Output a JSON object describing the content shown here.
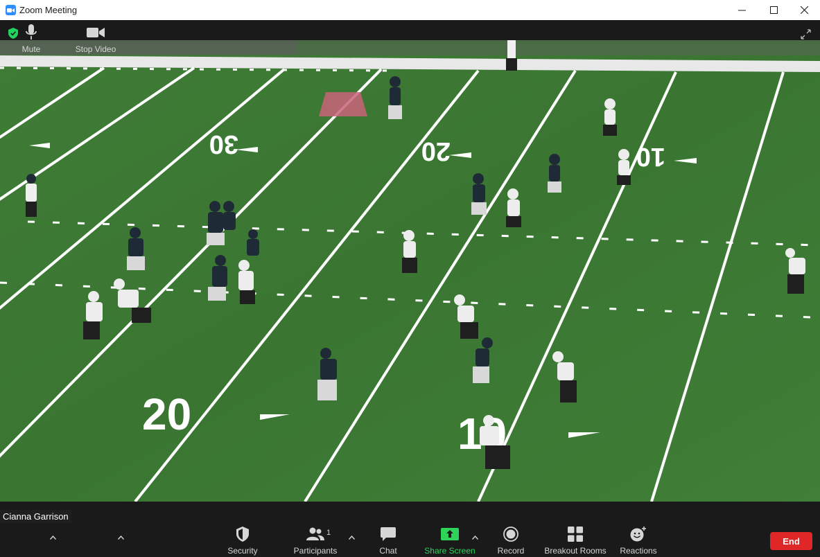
{
  "window": {
    "title": "Zoom Meeting"
  },
  "participant": {
    "name": "Cianna Garrison"
  },
  "toolbar": {
    "mute": "Mute",
    "stop_video": "Stop Video",
    "security": "Security",
    "participants": "Participants",
    "participants_count": "1",
    "chat": "Chat",
    "share_screen": "Share Screen",
    "record": "Record",
    "breakout_rooms": "Breakout Rooms",
    "reactions": "Reactions",
    "end": "End"
  },
  "field": {
    "yard_numbers": [
      "30",
      "20",
      "10",
      "20",
      "10"
    ],
    "colors": {
      "grass": "#3d7a35",
      "lines": "#ffffff",
      "sideline": "#e8e8e8"
    }
  },
  "colors": {
    "accent_green": "#2ed35a",
    "end_red": "#e02727",
    "toolbar_bg": "#1a1a1a"
  }
}
